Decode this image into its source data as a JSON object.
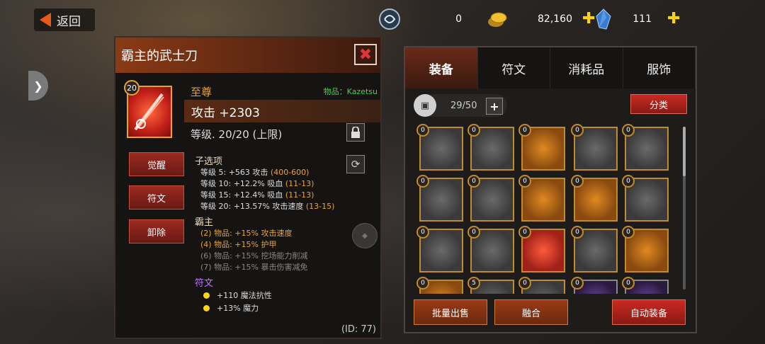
{
  "topbar": {
    "back_label": "返回",
    "resources": [
      {
        "name": "soul-orb-icon",
        "value": "0"
      },
      {
        "name": "gold-coin-icon",
        "value": "82,160"
      },
      {
        "name": "crystal-icon",
        "value": "111"
      }
    ]
  },
  "item": {
    "title": "霸主的武士刀",
    "level_badge": "20",
    "rarity": "至尊",
    "owner": "物品：Kazetsu",
    "attack": "攻击 +2303",
    "level_text": "等级. 20/20 (上限)",
    "buttons": {
      "awaken": "觉醒",
      "rune": "符文",
      "remove": "卸除"
    },
    "suboptions_title": "子选项",
    "suboptions": [
      {
        "text": "等级 5: +563 攻击 ",
        "range": "(400-600)"
      },
      {
        "text": "等级 10: +12.2% 吸血 ",
        "range": "(11-13)"
      },
      {
        "text": "等级 15: +12.4% 吸血 ",
        "range": "(11-13)"
      },
      {
        "text": "等级 20: +13.57% 攻击速度 ",
        "range": "(13-15)"
      }
    ],
    "set_title": "霸主",
    "set_bonuses": [
      {
        "text": "(2) 物品: +15% 攻击速度",
        "active": true
      },
      {
        "text": "(4) 物品: +15% 护甲",
        "active": true
      },
      {
        "text": "(6) 物品: +15% 挖场能力削减",
        "active": false
      },
      {
        "text": "(7) 物品: +15% 暴击伤害减免",
        "active": false
      }
    ],
    "rune_title": "符文",
    "runes": [
      "+110 魔法抗性",
      "+13% 魔力"
    ],
    "id_label": "(ID: 77)"
  },
  "inventory": {
    "tabs": [
      "装备",
      "符文",
      "消耗品",
      "服饰"
    ],
    "active_tab": 0,
    "capacity": "29/50",
    "sort_label": "分类",
    "grid_counts": [
      "0",
      "0",
      "0",
      "0",
      "0",
      "0",
      "0",
      "0",
      "0",
      "0",
      "0",
      "0",
      "0",
      "0",
      "0",
      "0",
      "5",
      "0",
      "0",
      "0"
    ],
    "bottom_buttons": {
      "bulk_sell": "批量出售",
      "merge": "融合",
      "auto_equip": "自动装备"
    }
  },
  "colors": {
    "accent": "#e85a1a",
    "gold": "#e6a23c",
    "green": "#4ad04a",
    "rune": "#c070ff"
  }
}
